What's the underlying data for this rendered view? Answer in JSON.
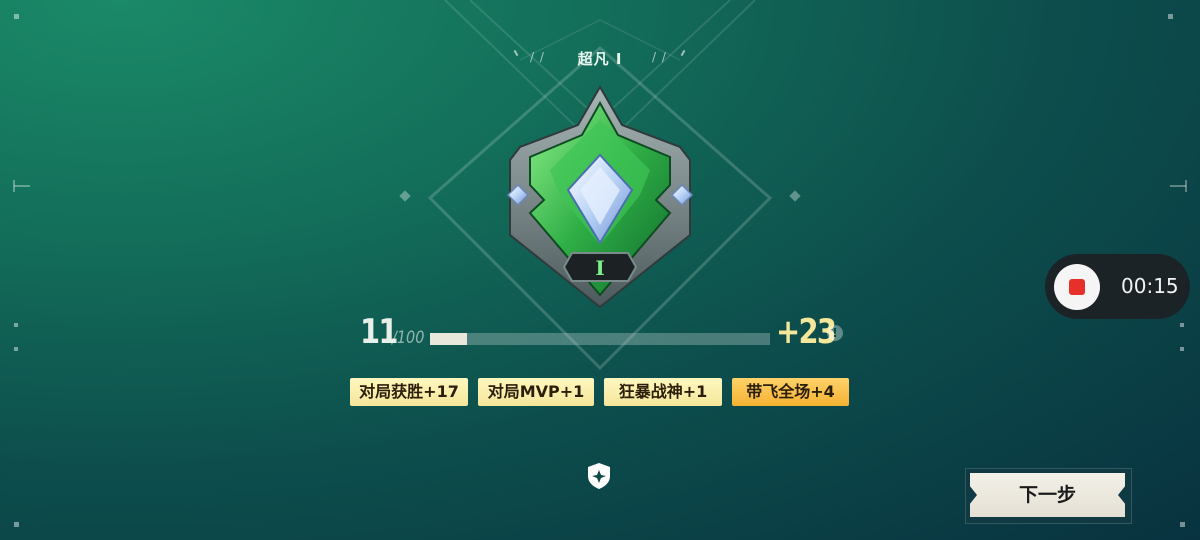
{
  "rank": {
    "title": "超凡 I",
    "badge_numeral": "I",
    "colors": {
      "gem": "#4fd16a",
      "crystal": "#b8d6ff",
      "frame": "#8a9a9a"
    }
  },
  "progress": {
    "current": "11",
    "max": "/100",
    "fraction": 0.11,
    "gain": "+23",
    "info_glyph": "!"
  },
  "rewards": [
    {
      "label": "对局获胜+17",
      "style": "yellow"
    },
    {
      "label": "对局MVP+1",
      "style": "yellow"
    },
    {
      "label": "狂暴战神+1",
      "style": "yellow"
    },
    {
      "label": "带飞全场+4",
      "style": "orange"
    }
  ],
  "recording": {
    "time": "00:15",
    "stop_icon": "stop-record-icon"
  },
  "next_button": {
    "label": "下一步"
  },
  "icons": {
    "shield": "shield-star-icon",
    "info": "info-icon"
  }
}
